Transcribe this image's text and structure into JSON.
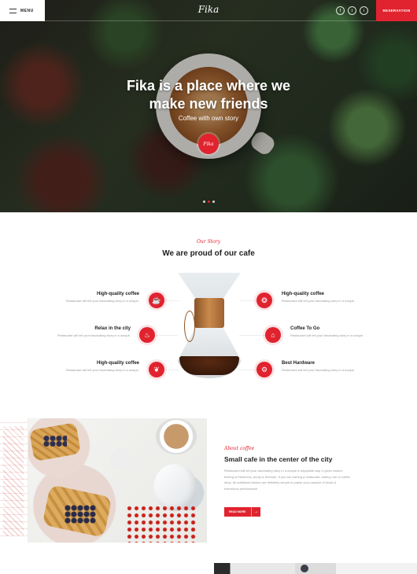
{
  "header": {
    "menu_label": "MENU",
    "logo": "Fika",
    "socials": [
      "f",
      "t",
      "i"
    ],
    "social_icons": [
      "facebook-icon",
      "twitter-icon",
      "instagram-icon"
    ],
    "reservation_label": "RESERVATION"
  },
  "hero": {
    "title_line1": "Fika is a place where we",
    "title_line2": "make new friends",
    "subtitle": "Coffee with own story",
    "badge": "Fika",
    "slides": 3,
    "active_slide": 2
  },
  "story": {
    "kicker": "Our Story",
    "title": "We are proud of our cafe",
    "features_left": [
      {
        "title": "High-quality coffee",
        "text": "Restaurant will tell your fascinating story in a unique.",
        "icon": "coffee-cup-icon"
      },
      {
        "title": "Relax in the city",
        "text": "Restaurant will tell your fascinating story in a unique.",
        "icon": "tea-cup-icon"
      },
      {
        "title": "High-quality coffee",
        "text": "Restaurant will tell your fascinating story in a unique.",
        "icon": "coffee-beans-icon"
      }
    ],
    "features_right": [
      {
        "title": "High-quality coffee",
        "text": "Restaurant will tell your fascinating story in a unique.",
        "icon": "coffee-bean-icon"
      },
      {
        "title": "Coffee To Go",
        "text": "Restaurant will tell your fascinating story in a unique.",
        "icon": "takeaway-cup-icon"
      },
      {
        "title": "Best Hardware",
        "text": "Restaurant will tell your fascinating story in a unique.",
        "icon": "coffee-machine-icon"
      }
    ]
  },
  "about": {
    "kicker": "About coffee",
    "title": "Small cafe in the center of the city",
    "text": "Restaurant will tell your fascinating story in a unique & enjoyable way. It gives visitors feeling of freshness, purity & freedom. If you are owning a restaurant, bakery, bar or coffee shop. All additional factors are definitely simple to praise your passion of foods & marvelous performance.",
    "button_label": "READ MORE",
    "button_arrow": "→"
  },
  "colors": {
    "accent": "#e0232e",
    "text": "#222222",
    "muted": "#999999"
  }
}
